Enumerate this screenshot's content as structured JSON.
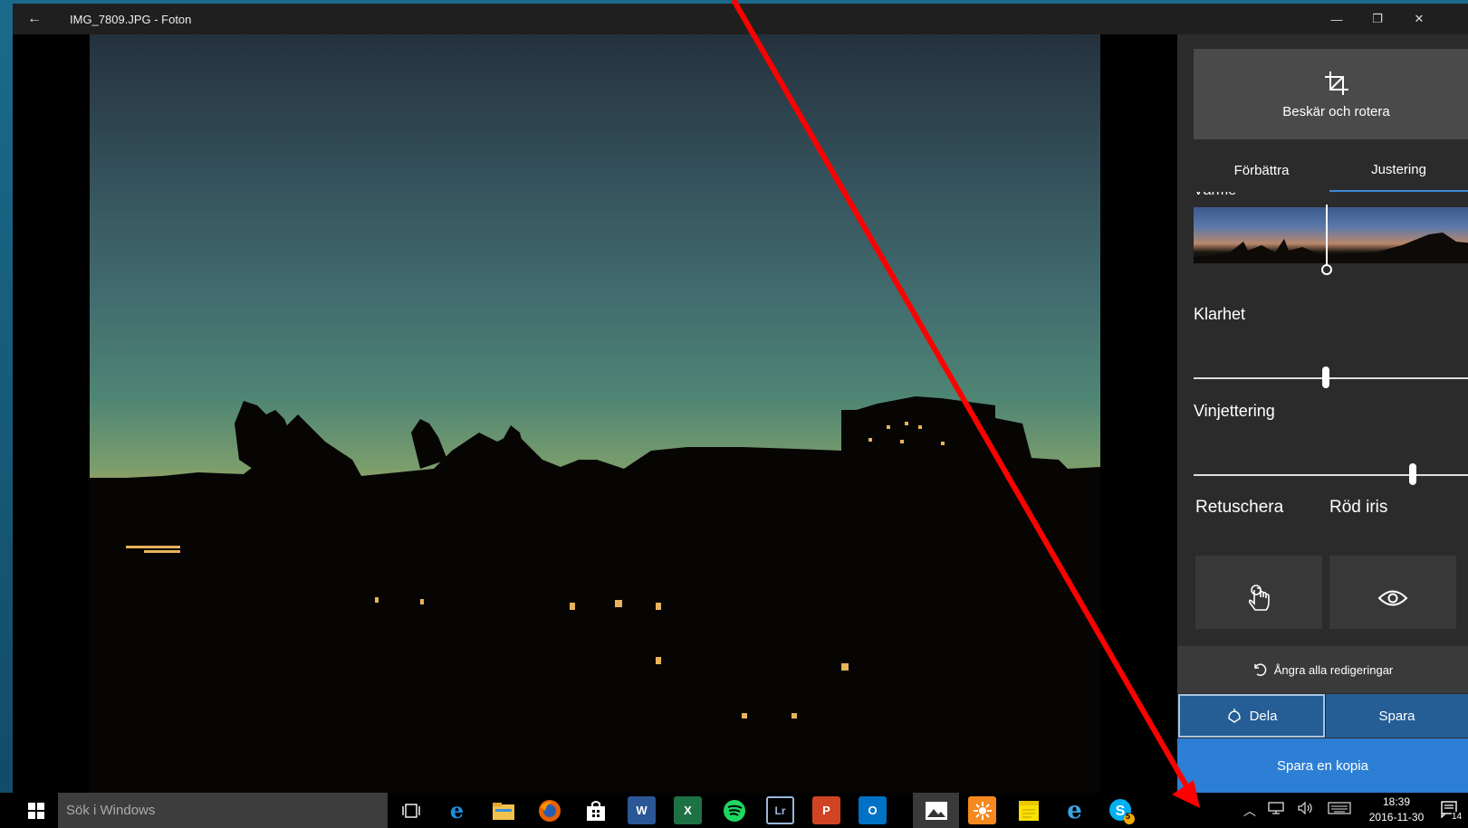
{
  "window": {
    "title": "IMG_7809.JPG - Foton",
    "controls": [
      "minimize",
      "maximize",
      "close"
    ]
  },
  "edit_panel": {
    "crop_label": "Beskär och rotera",
    "tabs": [
      {
        "label": "Förbättra",
        "active": false
      },
      {
        "label": "Justering",
        "active": true
      }
    ],
    "varme_label": "Värme",
    "sliders": [
      {
        "label": "Klarhet",
        "value": 0.5
      },
      {
        "label": "Vinjettering",
        "value": 0.81
      }
    ],
    "tools": {
      "retuschera_label": "Retuschera",
      "rod_iris_label": "Röd iris"
    },
    "undo_label": "Ångra alla redigeringar",
    "share_label": "Dela",
    "save_label": "Spara",
    "save_copy_label": "Spara en kopia"
  },
  "taskbar": {
    "search_placeholder": "Sök i Windows",
    "apps": [
      "task-view",
      "edge",
      "file-explorer",
      "firefox",
      "store",
      "word",
      "excel",
      "spotify",
      "lightroom",
      "powerpoint",
      "outlook",
      "photos",
      "sunflower",
      "sticky-notes",
      "internet-explorer",
      "skype"
    ],
    "skype_badge": "5",
    "time": "18:39",
    "date": "2016-11-30",
    "notification_count": "14"
  },
  "colors": {
    "accent": "#2d7fd6",
    "share_save_bg": "#255d95",
    "annotation_arrow": "#ff0000"
  }
}
